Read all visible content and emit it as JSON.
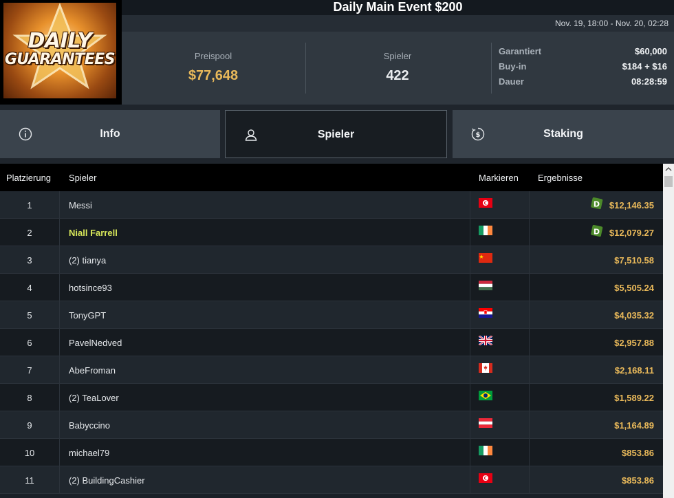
{
  "logo": {
    "line1": "DAILY",
    "line2": "GUARANTEES"
  },
  "header": {
    "title": "Daily Main Event $200",
    "date_range": "Nov. 19, 18:00 - Nov. 20, 02:28"
  },
  "stats": {
    "prize_pool_label": "Preispool",
    "prize_pool_value": "$77,648",
    "players_label": "Spieler",
    "players_value": "422",
    "details": [
      {
        "label": "Garantiert",
        "value": "$60,000"
      },
      {
        "label": "Buy-in",
        "value": "$184 + $16"
      },
      {
        "label": "Dauer",
        "value": "08:28:59"
      }
    ]
  },
  "tabs": [
    {
      "label": "Info",
      "icon": "info-icon",
      "active": false
    },
    {
      "label": "Spieler",
      "icon": "user-icon",
      "active": true
    },
    {
      "label": "Staking",
      "icon": "dollar-circle-icon",
      "active": false
    }
  ],
  "table": {
    "headers": {
      "rank": "Platzierung",
      "player": "Spieler",
      "flag": "Markieren",
      "result": "Ergebnisse"
    },
    "rows": [
      {
        "rank": "1",
        "player": "Messi",
        "country": "Tunisia",
        "result": "$12,146.35",
        "badge": "D",
        "highlight": false
      },
      {
        "rank": "2",
        "player": "Niall Farrell",
        "country": "Ireland",
        "result": "$12,079.27",
        "badge": "D",
        "highlight": true
      },
      {
        "rank": "3",
        "player": "(2) tianya",
        "country": "China",
        "result": "$7,510.58",
        "badge": "",
        "highlight": false
      },
      {
        "rank": "4",
        "player": "hotsince93",
        "country": "Hungary",
        "result": "$5,505.24",
        "badge": "",
        "highlight": false
      },
      {
        "rank": "5",
        "player": "TonyGPT",
        "country": "Croatia",
        "result": "$4,035.32",
        "badge": "",
        "highlight": false
      },
      {
        "rank": "6",
        "player": "PavelNedved",
        "country": "United Kingdom",
        "result": "$2,957.88",
        "badge": "",
        "highlight": false
      },
      {
        "rank": "7",
        "player": "AbeFroman",
        "country": "Canada",
        "result": "$2,168.11",
        "badge": "",
        "highlight": false
      },
      {
        "rank": "8",
        "player": "(2) TeaLover",
        "country": "Brazil",
        "result": "$1,589.22",
        "badge": "",
        "highlight": false
      },
      {
        "rank": "9",
        "player": "Babyccino",
        "country": "Austria",
        "result": "$1,164.89",
        "badge": "",
        "highlight": false
      },
      {
        "rank": "10",
        "player": "michael79",
        "country": "Ireland",
        "result": "$853.86",
        "badge": "",
        "highlight": false
      },
      {
        "rank": "11",
        "player": "(2) BuildingCashier",
        "country": "Tunisia",
        "result": "$853.86",
        "badge": "",
        "highlight": false
      }
    ]
  },
  "colors": {
    "accent_gold": "#e9b95a",
    "highlight_name": "#d8e85a",
    "badge_green": "#4c8a2a"
  }
}
